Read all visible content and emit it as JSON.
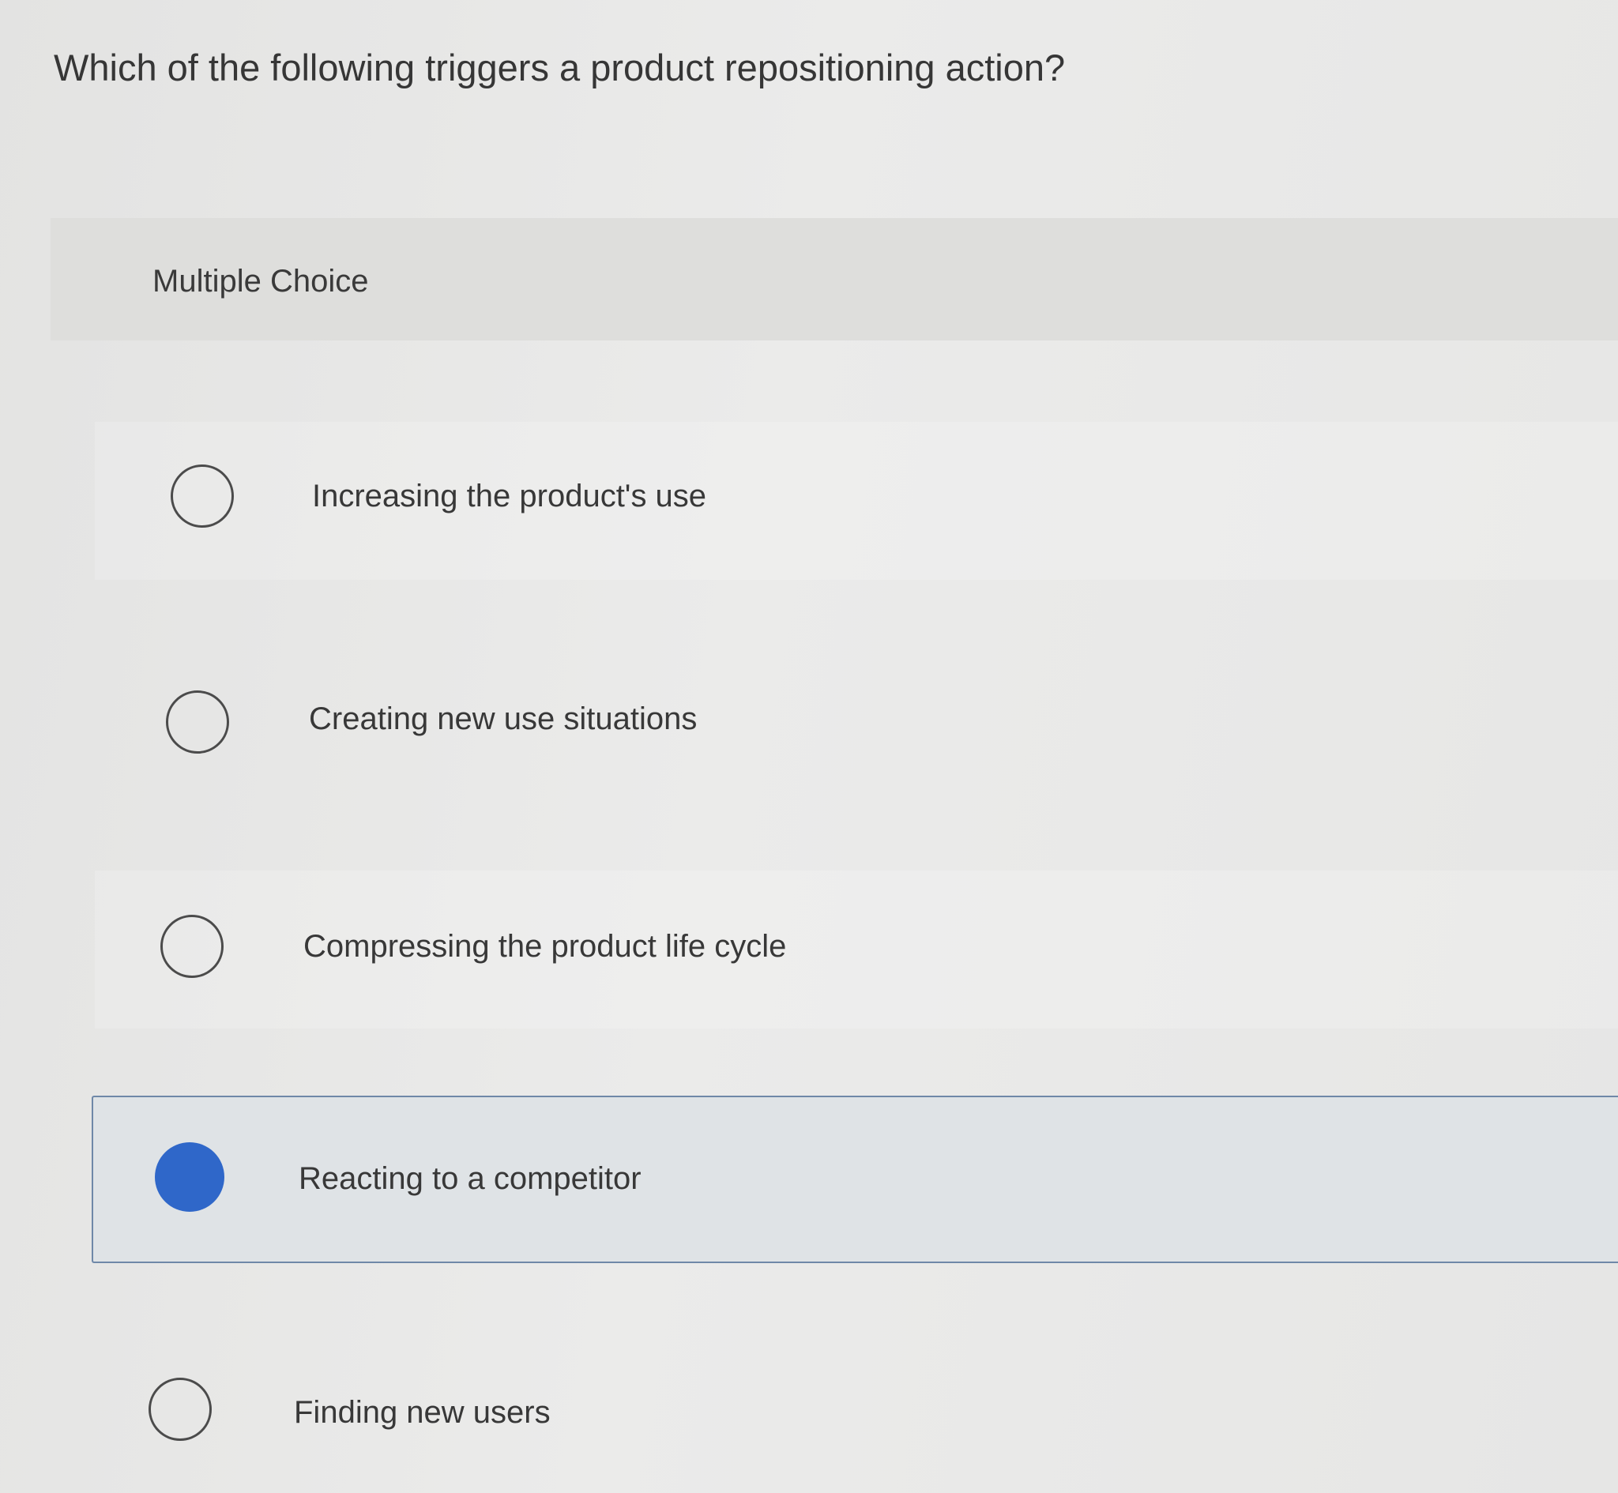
{
  "question": {
    "text": "Which of the following triggers a product repositioning action?"
  },
  "choice_block": {
    "label": "Multiple Choice",
    "selected_index": 3,
    "options": [
      {
        "label": "Increasing the product's use",
        "selected": false
      },
      {
        "label": "Creating new use situations",
        "selected": false
      },
      {
        "label": "Compressing the product life cycle",
        "selected": false
      },
      {
        "label": "Reacting to a competitor",
        "selected": true
      },
      {
        "label": "Finding new users",
        "selected": false
      }
    ]
  },
  "colors": {
    "selected_radio": "#2f67c9",
    "selected_border": "#6f88a8",
    "selected_background": "#dfe3e6"
  }
}
